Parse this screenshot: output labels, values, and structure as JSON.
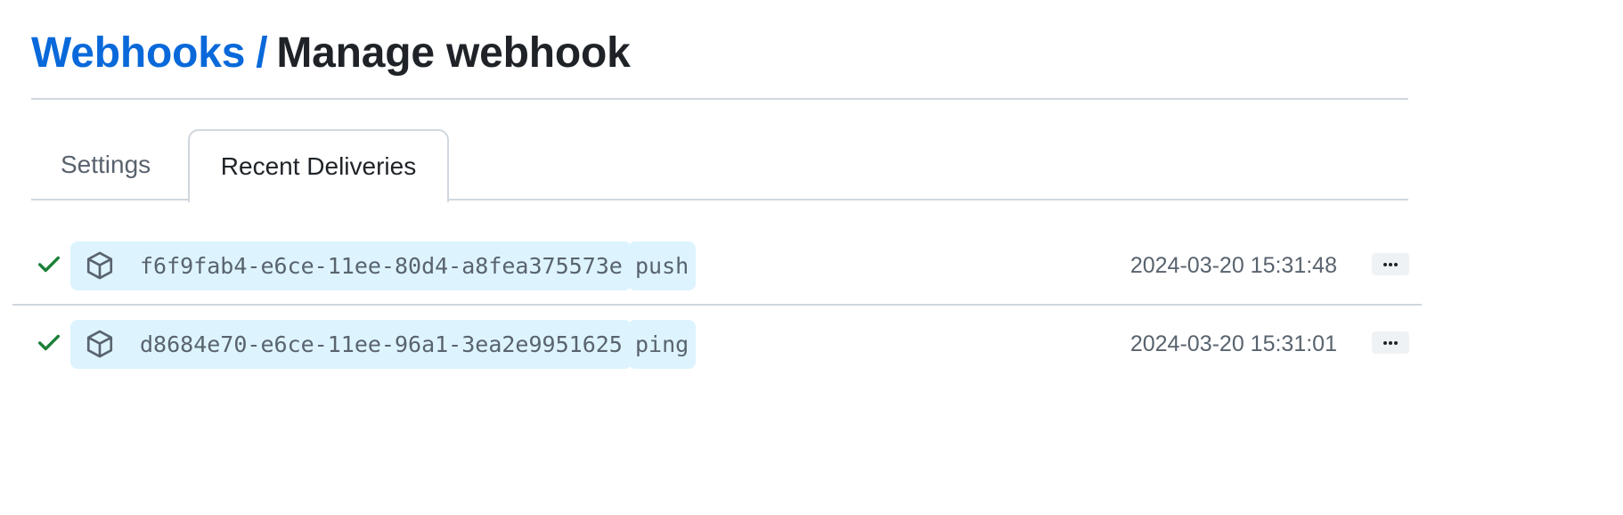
{
  "breadcrumb": {
    "parent_label": "Webhooks",
    "separator": "/",
    "current_label": "Manage webhook"
  },
  "tabs": [
    {
      "label": "Settings",
      "selected": false
    },
    {
      "label": "Recent Deliveries",
      "selected": true
    }
  ],
  "deliveries": [
    {
      "status_icon": "check-icon",
      "delivery_icon": "package-icon",
      "guid": "f6f9fab4-e6ce-11ee-80d4-a8fea375573e",
      "event": "push",
      "timestamp": "2024-03-20 15:31:48",
      "menu_icon": "kebab-horizontal-icon"
    },
    {
      "status_icon": "check-icon",
      "delivery_icon": "package-icon",
      "guid": "d8684e70-e6ce-11ee-96a1-3ea2e9951625",
      "event": "ping",
      "timestamp": "2024-03-20 15:31:01",
      "menu_icon": "kebab-horizontal-icon"
    }
  ],
  "colors": {
    "link": "#0969da",
    "success": "#1a7f37",
    "pill_background": "#ddf4ff",
    "muted_text": "#59636e",
    "border": "#d0d7de"
  }
}
